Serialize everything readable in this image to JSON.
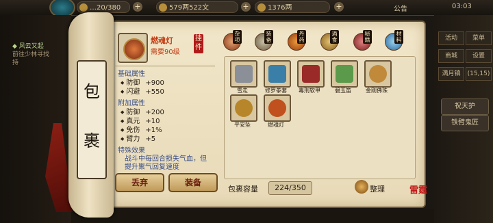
{
  "hud": {
    "top_res_1": "…20/380",
    "top_res_2": "579两522文",
    "top_res_3": "1376两",
    "announce": "公告",
    "clock": "03:03",
    "quest_title": "◆ 风云又起",
    "quest_desc": "前往少林寻找",
    "quest_desc2": "持",
    "right_buttons": [
      "活动",
      "菜单",
      "商城",
      "设置",
      "满月镇",
      "(15,15)"
    ],
    "right_actions": [
      "祝天护",
      "铁臂鬼匠"
    ]
  },
  "panel": {
    "title_chars": [
      "包",
      "裹"
    ]
  },
  "item": {
    "name": "燃魂灯",
    "requirement": "需要90级",
    "equipped_tag": "挂件",
    "base_title": "基础属性",
    "base_attrs": [
      {
        "name": "防御",
        "value": "+900"
      },
      {
        "name": "闪避",
        "value": "+550"
      }
    ],
    "extra_title": "附加属性",
    "extra_attrs": [
      {
        "name": "防御",
        "value": "+200"
      },
      {
        "name": "真元",
        "value": "+10"
      },
      {
        "name": "免伤",
        "value": "+1%"
      },
      {
        "name": "臂力",
        "value": "+5"
      }
    ],
    "special_title": "特殊效果",
    "special_text": "战斗中每回合损失气血，但提升聚气回复速度"
  },
  "buttons": {
    "discard": "丢弃",
    "equip": "装备",
    "sort": "整理"
  },
  "tabs": [
    "杂项",
    "装备",
    "丹药",
    "酒食",
    "秘籍",
    "材料"
  ],
  "inventory": {
    "items": [
      {
        "name": "雪走",
        "color": "#8a8f98"
      },
      {
        "name": "修罗拳套",
        "color": "#3a7fa8"
      },
      {
        "name": "毒刑软甲",
        "color": "#9a2a28"
      },
      {
        "name": "碧玉笛",
        "color": "#5a9a4a"
      },
      {
        "name": "金刚佛珠",
        "color": "#c08a3a"
      },
      {
        "name": "平安坠",
        "color": "#b8862a"
      },
      {
        "name": "燃魂灯",
        "color": "#c0501e"
      }
    ],
    "capacity_label": "包裹容量",
    "capacity_value": "224/350"
  },
  "seal": "雷霆"
}
